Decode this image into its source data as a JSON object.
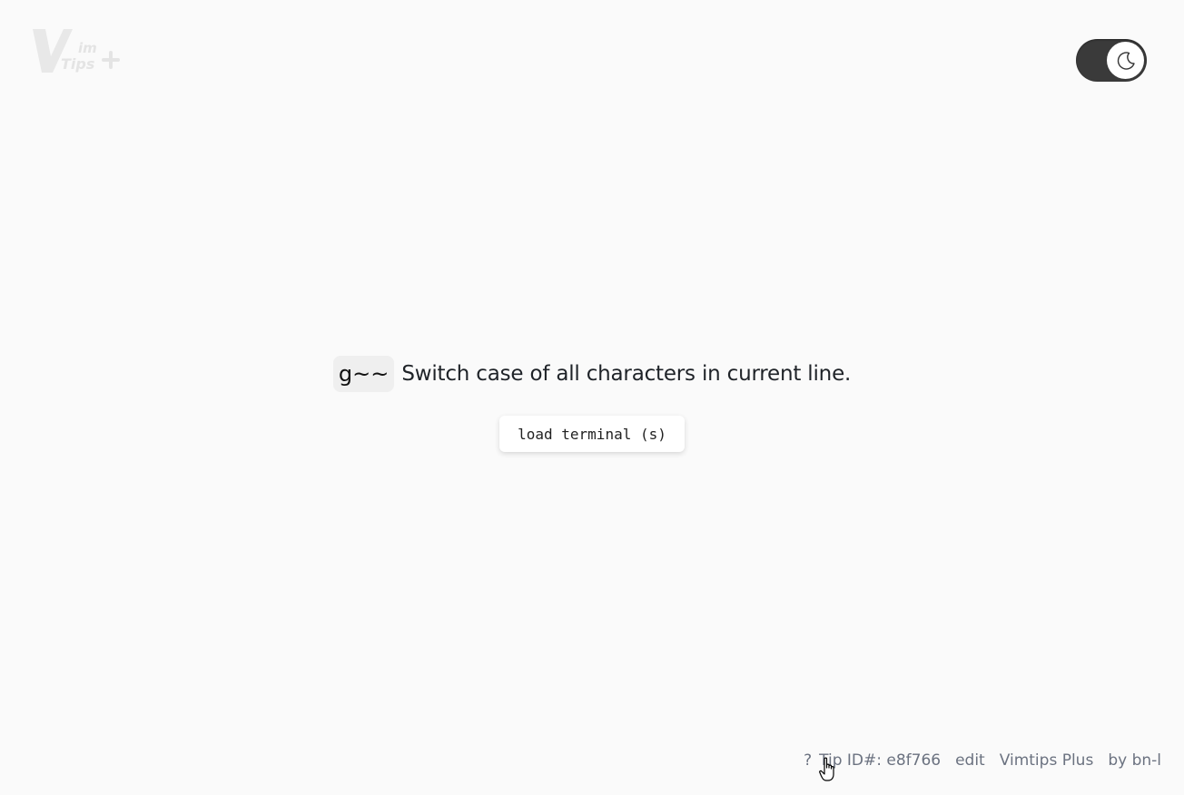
{
  "logo": {
    "alt_letter": "V",
    "alt_top": "im",
    "alt_bottom": "Tips",
    "alt_plus": "+"
  },
  "theme_toggle": {
    "state": "dark",
    "icon": "moon-icon"
  },
  "tip": {
    "keys": "g~~",
    "description": "Switch case of all characters in current line."
  },
  "load_button": {
    "label": "load terminal (s)"
  },
  "footer": {
    "help": "?",
    "tip_id": "Tip ID#: e8f766",
    "edit": "edit",
    "site": "Vimtips Plus",
    "author": "by bn-l"
  },
  "colors": {
    "background": "#fafafa",
    "toggle_bg": "#3a3a3a",
    "footer_text": "#6b7280",
    "logo": "#e6e6e6"
  }
}
